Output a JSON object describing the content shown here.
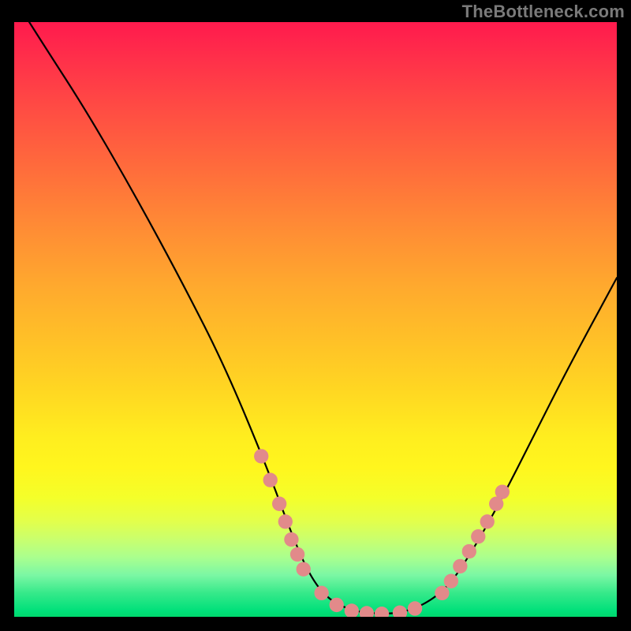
{
  "attribution": "TheBottleneck.com",
  "colors": {
    "background_frame": "#000000",
    "gradient_top": "#ff1a4d",
    "gradient_mid": "#ffee1f",
    "gradient_bottom": "#00d76d",
    "curve": "#000000",
    "marker": "#e28a8a",
    "attribution_text": "#7a7a7a"
  },
  "chart_data": {
    "type": "line",
    "title": "",
    "xlabel": "",
    "ylabel": "",
    "xlim": [
      0,
      100
    ],
    "ylim": [
      0,
      100
    ],
    "note": "Axes unlabeled in source image; x/y are normalized 0–100 percent of plot area. y=100 at top (maximum bottleneck/red), y≈0 at bottom (minimum/green). Curve is a V/notch shape.",
    "series": [
      {
        "name": "bottleneck-curve",
        "points": [
          {
            "x": 0,
            "y": 104
          },
          {
            "x": 5,
            "y": 96
          },
          {
            "x": 12,
            "y": 85
          },
          {
            "x": 20,
            "y": 71
          },
          {
            "x": 28,
            "y": 56
          },
          {
            "x": 35,
            "y": 42
          },
          {
            "x": 42,
            "y": 25
          },
          {
            "x": 46,
            "y": 14
          },
          {
            "x": 49,
            "y": 7
          },
          {
            "x": 52,
            "y": 3
          },
          {
            "x": 56,
            "y": 1
          },
          {
            "x": 60,
            "y": 0.5
          },
          {
            "x": 64,
            "y": 0.6
          },
          {
            "x": 68,
            "y": 2
          },
          {
            "x": 72,
            "y": 5
          },
          {
            "x": 76,
            "y": 11
          },
          {
            "x": 81,
            "y": 20
          },
          {
            "x": 86,
            "y": 30
          },
          {
            "x": 92,
            "y": 42
          },
          {
            "x": 100,
            "y": 57
          }
        ]
      }
    ],
    "markers": {
      "name": "highlighted-points",
      "description": "Salmon dots clustered on both flanks and floor of the notch.",
      "radius_percent": 1.2,
      "points": [
        {
          "x": 41,
          "y": 27
        },
        {
          "x": 42.5,
          "y": 23
        },
        {
          "x": 44,
          "y": 19
        },
        {
          "x": 45,
          "y": 16
        },
        {
          "x": 46,
          "y": 13
        },
        {
          "x": 47,
          "y": 10.5
        },
        {
          "x": 48,
          "y": 8
        },
        {
          "x": 51,
          "y": 4
        },
        {
          "x": 53.5,
          "y": 2
        },
        {
          "x": 56,
          "y": 1
        },
        {
          "x": 58.5,
          "y": 0.6
        },
        {
          "x": 61,
          "y": 0.5
        },
        {
          "x": 64,
          "y": 0.7
        },
        {
          "x": 66.5,
          "y": 1.4
        },
        {
          "x": 71,
          "y": 4
        },
        {
          "x": 72.5,
          "y": 6
        },
        {
          "x": 74,
          "y": 8.5
        },
        {
          "x": 75.5,
          "y": 11
        },
        {
          "x": 77,
          "y": 13.5
        },
        {
          "x": 78.5,
          "y": 16
        },
        {
          "x": 80,
          "y": 19
        },
        {
          "x": 81,
          "y": 21
        }
      ]
    }
  }
}
